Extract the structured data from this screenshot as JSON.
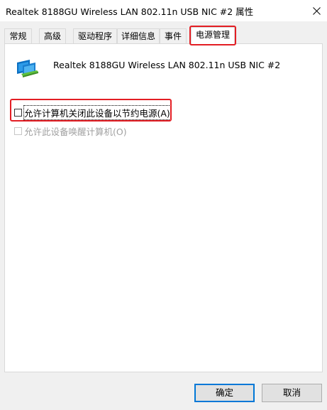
{
  "window": {
    "title": "Realtek 8188GU Wireless LAN 802.11n USB NIC #2 属性"
  },
  "tabs": [
    {
      "label": "常规"
    },
    {
      "label": "高级"
    },
    {
      "label": "驱动程序"
    },
    {
      "label": "详细信息"
    },
    {
      "label": "事件"
    },
    {
      "label": "电源管理",
      "active": true
    }
  ],
  "device": {
    "name": "Realtek 8188GU Wireless LAN 802.11n USB NIC #2",
    "icon": "network-adapter-icon"
  },
  "options": [
    {
      "label": "允许计算机关闭此设备以节约电源(A)",
      "checked": false,
      "enabled": true,
      "underline": "A"
    },
    {
      "label": "允许此设备唤醒计算机(O)",
      "checked": false,
      "enabled": false,
      "underline": "O"
    }
  ],
  "buttons": {
    "ok": "确定",
    "cancel": "取消"
  },
  "colors": {
    "highlight": "#e31e24",
    "default_button_border": "#0078d7",
    "disabled_text": "#a0a0a0"
  }
}
